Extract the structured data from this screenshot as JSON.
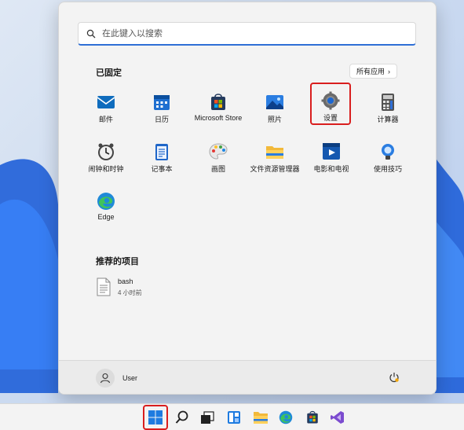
{
  "search": {
    "placeholder": "在此键入以搜索"
  },
  "pinned": {
    "title": "已固定",
    "all_apps_label": "所有应用",
    "apps": [
      {
        "label": "邮件",
        "icon": "mail-icon"
      },
      {
        "label": "日历",
        "icon": "calendar-icon"
      },
      {
        "label": "Microsoft Store",
        "icon": "store-icon"
      },
      {
        "label": "照片",
        "icon": "photos-icon"
      },
      {
        "label": "设置",
        "icon": "settings-gear-icon",
        "highlighted": true
      },
      {
        "label": "计算器",
        "icon": "calculator-icon"
      },
      {
        "label": "闹钟和时钟",
        "icon": "clock-icon"
      },
      {
        "label": "记事本",
        "icon": "notepad-icon"
      },
      {
        "label": "画图",
        "icon": "paint-icon"
      },
      {
        "label": "文件资源管理器",
        "icon": "folder-icon"
      },
      {
        "label": "电影和电视",
        "icon": "movies-icon"
      },
      {
        "label": "使用技巧",
        "icon": "tips-icon"
      },
      {
        "label": "Edge",
        "icon": "edge-icon"
      }
    ]
  },
  "recommended": {
    "title": "推荐的项目",
    "items": [
      {
        "name": "bash",
        "time": "4 小时前",
        "icon": "file-icon"
      }
    ]
  },
  "footer": {
    "user_name": "User"
  },
  "taskbar": {
    "items": [
      "start-icon",
      "search-icon",
      "task-view-icon",
      "widgets-icon",
      "file-explorer-icon",
      "edge-icon",
      "store-icon",
      "visual-studio-icon"
    ],
    "start_highlighted": true
  },
  "colors": {
    "highlight": "#d91e1e",
    "accent": "#2f6fd6"
  }
}
